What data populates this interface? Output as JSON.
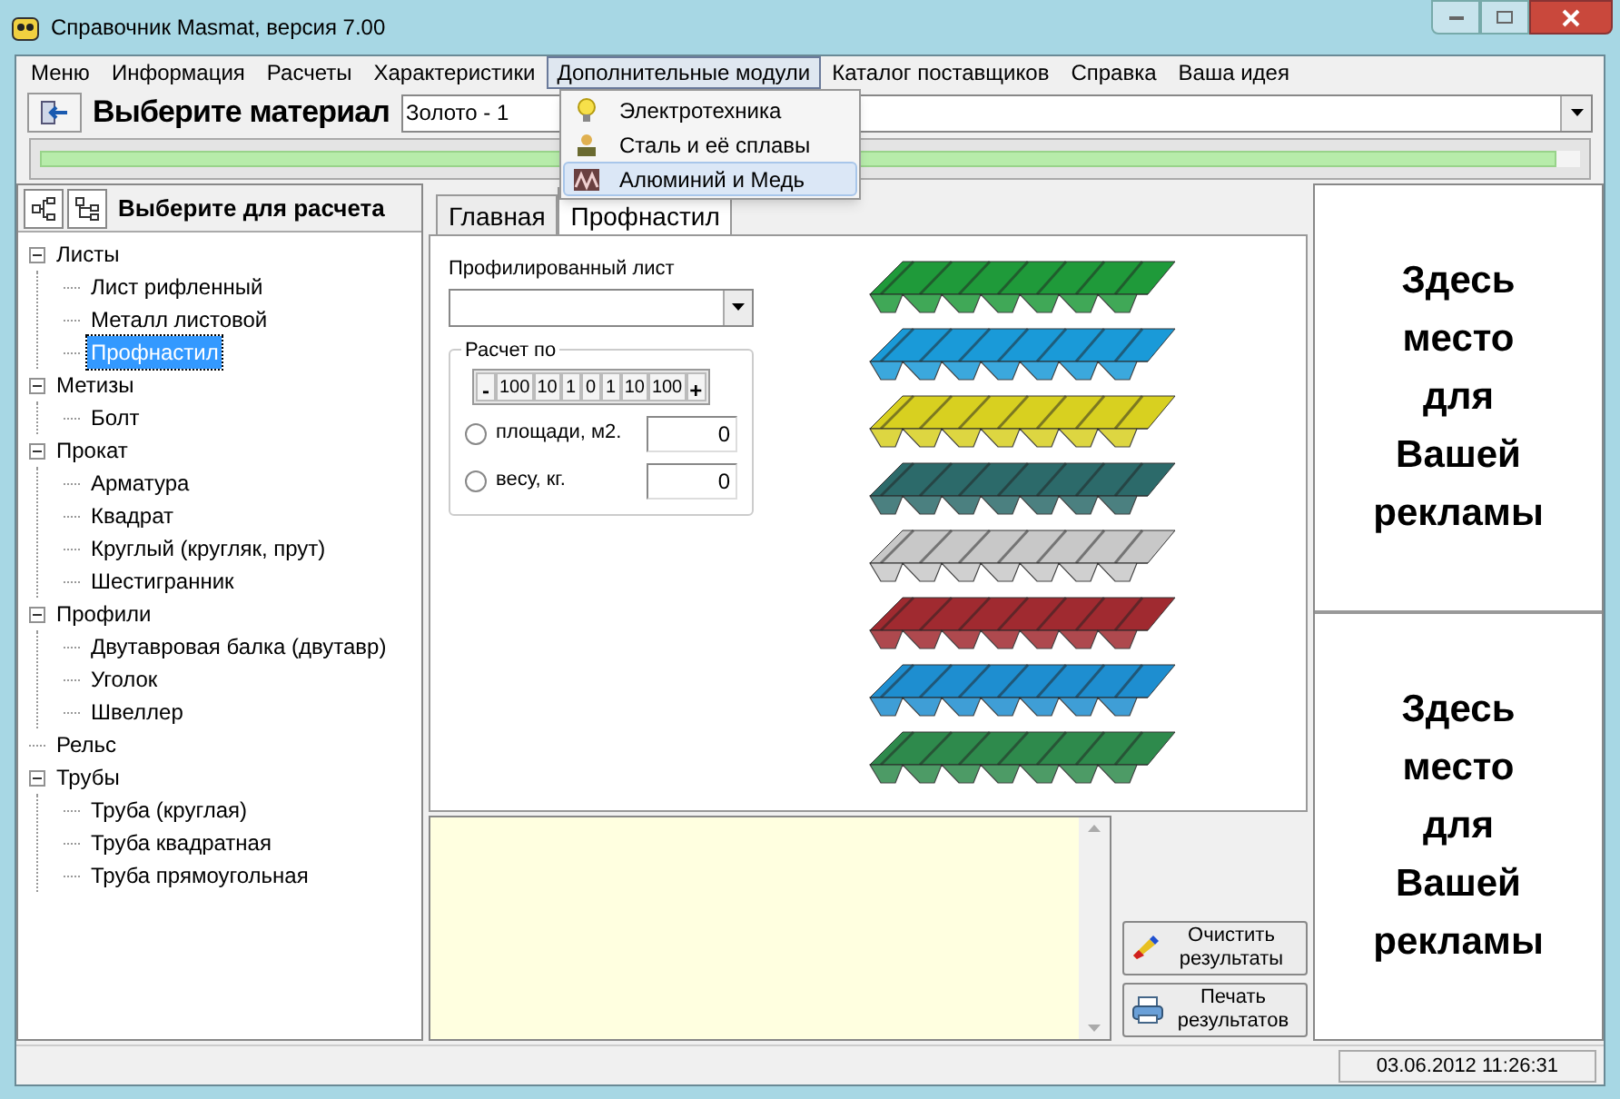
{
  "window": {
    "title": "Справочник Masmat, версия 7.00"
  },
  "menu": [
    {
      "label": "Меню",
      "open": false
    },
    {
      "label": "Информация",
      "open": false
    },
    {
      "label": "Расчеты",
      "open": false
    },
    {
      "label": "Характеристики",
      "open": false
    },
    {
      "label": "Дополнительные модули",
      "open": true
    },
    {
      "label": "Каталог поставщиков",
      "open": false
    },
    {
      "label": "Справка",
      "open": false
    },
    {
      "label": "Ваша идея",
      "open": false
    }
  ],
  "dropdown": [
    {
      "label": "Электротехника",
      "kind": "bulb",
      "selected": false
    },
    {
      "label": "Сталь и её сплавы",
      "kind": "steel",
      "selected": false
    },
    {
      "label": "Алюминий и Медь",
      "kind": "metal",
      "selected": true
    }
  ],
  "toolbar": {
    "heading": "Выберите материал",
    "material": "Золото - 1"
  },
  "progress": {
    "level": 0.985
  },
  "sidebar": {
    "heading": "Выберите для расчета",
    "tree": [
      {
        "label": "Листы",
        "expanded": true,
        "selected": false,
        "children": [
          {
            "label": "Лист рифленный",
            "selected": false
          },
          {
            "label": "Металл листовой",
            "selected": false
          },
          {
            "label": "Профнастил",
            "selected": true
          }
        ]
      },
      {
        "label": "Метизы",
        "expanded": true,
        "selected": false,
        "children": [
          {
            "label": "Болт",
            "selected": false
          }
        ]
      },
      {
        "label": "Прокат",
        "expanded": true,
        "selected": false,
        "children": [
          {
            "label": "Арматура",
            "selected": false
          },
          {
            "label": "Квадрат",
            "selected": false
          },
          {
            "label": "Круглый (кругляк, прут)",
            "selected": false
          },
          {
            "label": "Шестигранник",
            "selected": false
          }
        ]
      },
      {
        "label": "Профили",
        "expanded": true,
        "selected": false,
        "children": [
          {
            "label": "Двутавровая балка (двутавр)",
            "selected": false
          },
          {
            "label": "Уголок",
            "selected": false
          },
          {
            "label": "Швеллер",
            "selected": false
          }
        ]
      },
      {
        "label": "Рельс",
        "selected": false
      },
      {
        "label": "Трубы",
        "expanded": true,
        "selected": false,
        "children": [
          {
            "label": "Труба (круглая)",
            "selected": false
          },
          {
            "label": "Труба квадратная",
            "selected": false
          },
          {
            "label": "Труба прямоугольная",
            "selected": false
          }
        ]
      }
    ]
  },
  "tabs": [
    {
      "label": "Главная",
      "selected": false
    },
    {
      "label": "Профнастил",
      "selected": true
    }
  ],
  "form": {
    "sheet_label": "Профилированный лист",
    "group_label": "Расчет по",
    "steps": [
      "-",
      "100",
      "10",
      "1",
      "0",
      "1",
      "10",
      "100",
      "+"
    ],
    "options": [
      {
        "label": "площади, м2.",
        "selected": false,
        "value": "0"
      },
      {
        "label": "весу, кг.",
        "selected": false,
        "value": "0"
      }
    ]
  },
  "buttons": [
    {
      "label": "Очистить результаты",
      "kind": "clear"
    },
    {
      "label": "Печать результатов",
      "kind": "print"
    }
  ],
  "ads": [
    {
      "text": "Здесь место для Вашей рекламы"
    },
    {
      "text": "Здесь место для Вашей рекламы"
    }
  ],
  "status_bar": {
    "datetime": "03.06.2012 11:26:31"
  }
}
